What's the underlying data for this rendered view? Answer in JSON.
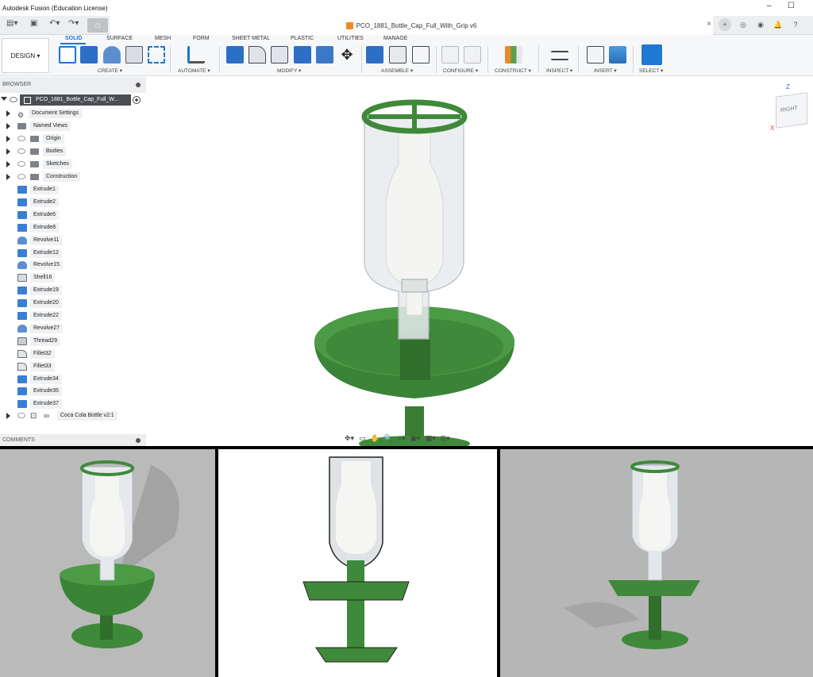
{
  "window": {
    "title": "Autodesk Fusion (Education License)",
    "minimize": "–",
    "maximize": "☐"
  },
  "document": {
    "tab_title": "PCO_1881_Bottle_Cap_Full_With_Grip v6",
    "close": "×"
  },
  "toolbar": {
    "workspace": "DESIGN ▾",
    "tabs": [
      "SOLID",
      "SURFACE",
      "MESH",
      "FORM",
      "SHEET METAL",
      "PLASTIC",
      "UTILITIES",
      "MANAGE"
    ],
    "groups": [
      "CREATE ▾",
      "AUTOMATE ▾",
      "MODIFY ▾",
      "ASSEMBLE ▾",
      "CONFIGURE ▾",
      "CONSTRUCT ▾",
      "INSPECT ▾",
      "INSERT ▾",
      "SELECT ▾"
    ]
  },
  "browser": {
    "title": "BROWSER",
    "root": "PCO_1881_Bottle_Cap_Full_W...",
    "folders": [
      "Document Settings",
      "Named Views",
      "Origin",
      "Bodies",
      "Sketches",
      "Construction"
    ],
    "features": [
      {
        "type": "extrude",
        "label": "Extrude1"
      },
      {
        "type": "extrude",
        "label": "Extrude2"
      },
      {
        "type": "extrude",
        "label": "Extrude6"
      },
      {
        "type": "extrude",
        "label": "Extrude8"
      },
      {
        "type": "revolve",
        "label": "Revolve11"
      },
      {
        "type": "extrude",
        "label": "Extrude12"
      },
      {
        "type": "revolve",
        "label": "Revolve15"
      },
      {
        "type": "shell",
        "label": "Shell16"
      },
      {
        "type": "extrude",
        "label": "Extrude19"
      },
      {
        "type": "extrude",
        "label": "Extrude20"
      },
      {
        "type": "extrude",
        "label": "Extrude22"
      },
      {
        "type": "revolve",
        "label": "Revolve27"
      },
      {
        "type": "thread",
        "label": "Thread29"
      },
      {
        "type": "fillet",
        "label": "Fillet32"
      },
      {
        "type": "fillet",
        "label": "Fillet33"
      },
      {
        "type": "extrude",
        "label": "Extrude34"
      },
      {
        "type": "extrude",
        "label": "Extrude35"
      },
      {
        "type": "extrude",
        "label": "Extrude37"
      }
    ],
    "component": "Coca Cola Bottle v2:1"
  },
  "comments": {
    "title": "COMMENTS"
  },
  "viewcube": {
    "face": "RIGHT",
    "z_axis": "Z",
    "x_axis": "X"
  },
  "colors": {
    "accent": "#1977d1",
    "part_green": "#3f8a3a",
    "part_green_dark": "#2e6a2b"
  }
}
